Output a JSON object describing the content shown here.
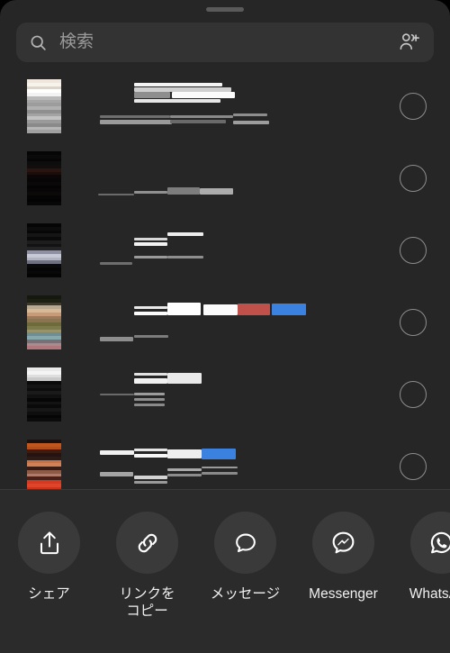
{
  "sheet": {
    "handle_name": "drag-handle"
  },
  "search": {
    "placeholder": "検索",
    "value": "",
    "icon": "search-icon",
    "add_people_icon": "add-people-icon"
  },
  "contacts": {
    "heading": "",
    "rows": [
      {
        "name_redacted": "",
        "subtitle_redacted": "",
        "selected": false,
        "avatar_colors": [
          "#efe7dd",
          "#f7f2ea",
          "#d9d4cc",
          "#ffffff",
          "#f2f2f2",
          "#b9b9b9",
          "#a6a6a6",
          "#9c9c9c",
          "#b0b0b0",
          "#8f8f8f",
          "#a3a3a3",
          "#c2c2c2",
          "#9a9a9a",
          "#8a8a8a",
          "#b5b5b5",
          "#a0a0a0"
        ],
        "badges": []
      },
      {
        "name_redacted": "",
        "subtitle_redacted": "",
        "selected": false,
        "avatar_colors": [
          "#050505",
          "#0a0a0a",
          "#060606",
          "#0d0d0d",
          "#120e0c",
          "#2a1410",
          "#1a0d0a",
          "#0b0707",
          "#070505",
          "#0a0808",
          "#050404",
          "#080606",
          "#0c0909",
          "#060505",
          "#040303",
          "#080707"
        ],
        "badges": []
      },
      {
        "name_redacted": "",
        "subtitle_redacted": "",
        "selected": false,
        "avatar_colors": [
          "#050505",
          "#0c0c0c",
          "#070707",
          "#151515",
          "#0a0a0a",
          "#1d1d1d",
          "#121212",
          "#242424",
          "#8f90a0",
          "#c8c9d6",
          "#b2b3c0",
          "#6f7080",
          "#0a0a0a",
          "#050505",
          "#080808",
          "#040404"
        ],
        "badges": []
      },
      {
        "name_redacted": "",
        "subtitle_redacted": "",
        "selected": false,
        "avatar_colors": [
          "#14180f",
          "#1b2013",
          "#3d3a2c",
          "#b9a88e",
          "#d8b896",
          "#c79a78",
          "#9d7a5c",
          "#8a7550",
          "#6e6a3c",
          "#7d7a4a",
          "#98936a",
          "#6f8e93",
          "#86a9ad",
          "#7b6f75",
          "#a98b8c",
          "#b0787c"
        ],
        "badges": [
          "#c0504a",
          "#3b82e0"
        ]
      },
      {
        "name_redacted": "",
        "subtitle_redacted": "",
        "selected": false,
        "avatar_colors": [
          "#e9e9e9",
          "#f4f4f4",
          "#dedede",
          "#c9c9c9",
          "#0a0a0a",
          "#141414",
          "#0c0c0c",
          "#1a1a1a",
          "#101010",
          "#060606",
          "#131313",
          "#0a0a0a",
          "#171717",
          "#0e0e0e",
          "#050505",
          "#0b0b0b"
        ],
        "badges": []
      },
      {
        "name_redacted": "",
        "subtitle_redacted": "",
        "selected": false,
        "avatar_colors": [
          "#1b1210",
          "#c2561f",
          "#b44f1c",
          "#3a1c12",
          "#241310",
          "#2e1a14",
          "#c4724a",
          "#d08157",
          "#3a1c14",
          "#8e5a48",
          "#b07a6a",
          "#4a2018",
          "#d33a22",
          "#e0442a",
          "#c7341d",
          "#a82b16"
        ],
        "badges": [
          "#3b82e0"
        ]
      }
    ]
  },
  "actions": [
    {
      "label": "シェア",
      "icon": "share-upload-icon"
    },
    {
      "label": "リンクを\nコピー",
      "icon": "link-icon"
    },
    {
      "label": "メッセージ",
      "icon": "message-bubble-icon"
    },
    {
      "label": "Messenger",
      "icon": "messenger-icon"
    },
    {
      "label": "WhatsApp",
      "icon": "whatsapp-icon"
    }
  ],
  "colors": {
    "sheet_bg": "#262626",
    "search_bg": "#333333",
    "actionbar_bg": "#2b2b2b",
    "divider": "#3a3a3a",
    "accent_blue": "#3b82e0",
    "accent_red": "#c0504a",
    "text": "#f0f0f0",
    "placeholder": "#9a9a9a"
  }
}
